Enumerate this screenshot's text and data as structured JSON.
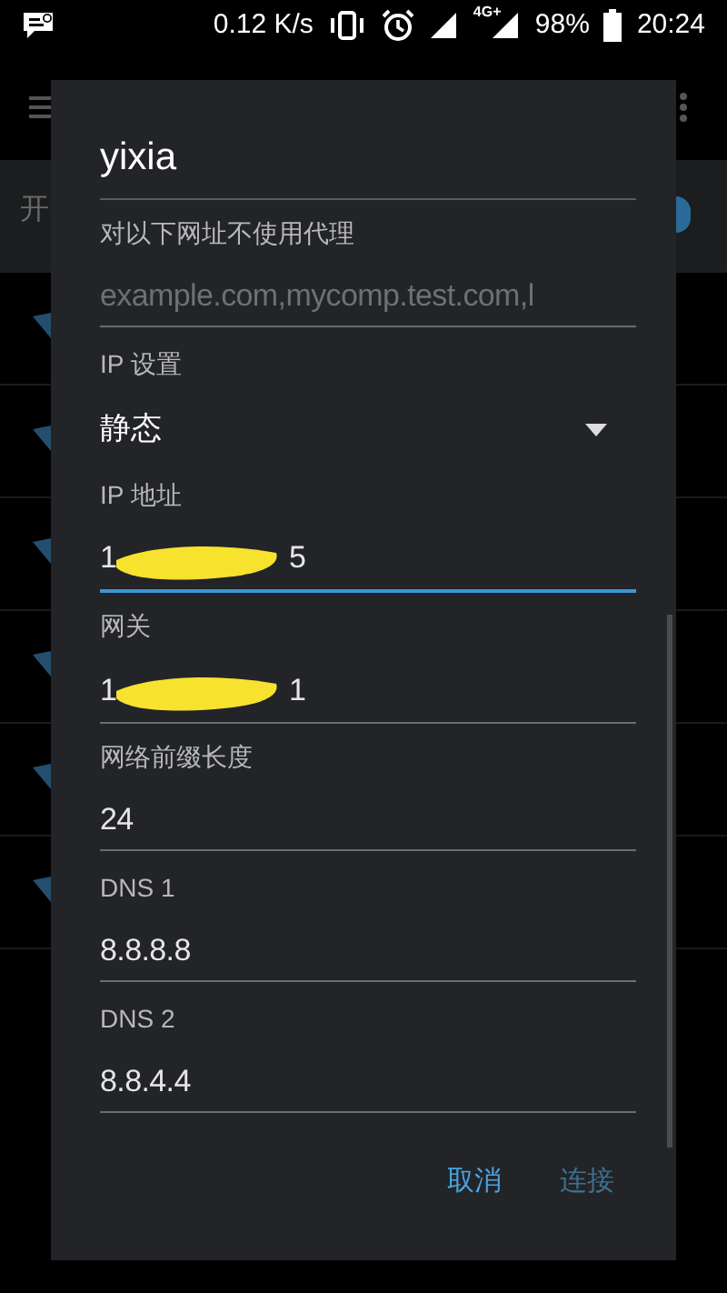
{
  "status_bar": {
    "speed": "0.12 K/s",
    "network_label": "4G+",
    "battery": "98%",
    "time": "20:24"
  },
  "background": {
    "header_text": "开",
    "toggle_on": true
  },
  "dialog": {
    "title": "yixia",
    "fields": [
      {
        "kind": "text",
        "label": "对以下网址不使用代理",
        "placeholder": "example.com,mycomp.test.com,l",
        "focused": false
      },
      {
        "kind": "dropdown",
        "label": "IP 设置",
        "value": "静态"
      },
      {
        "kind": "redacted",
        "label": "IP 地址",
        "value_start": "1",
        "value_end": "5",
        "focused": true
      },
      {
        "kind": "redacted",
        "label": "网关",
        "value_start": "1",
        "value_end": "1",
        "focused": false
      },
      {
        "kind": "text",
        "label": "网络前缀长度",
        "value": "24",
        "focused": false
      },
      {
        "kind": "text",
        "label": "DNS 1",
        "value": "8.8.8.8",
        "focused": false
      },
      {
        "kind": "text",
        "label": "DNS 2",
        "value": "8.8.4.4",
        "focused": false
      }
    ],
    "buttons": [
      {
        "label": "取消",
        "disabled": false
      },
      {
        "label": "连接",
        "disabled": true
      }
    ]
  }
}
